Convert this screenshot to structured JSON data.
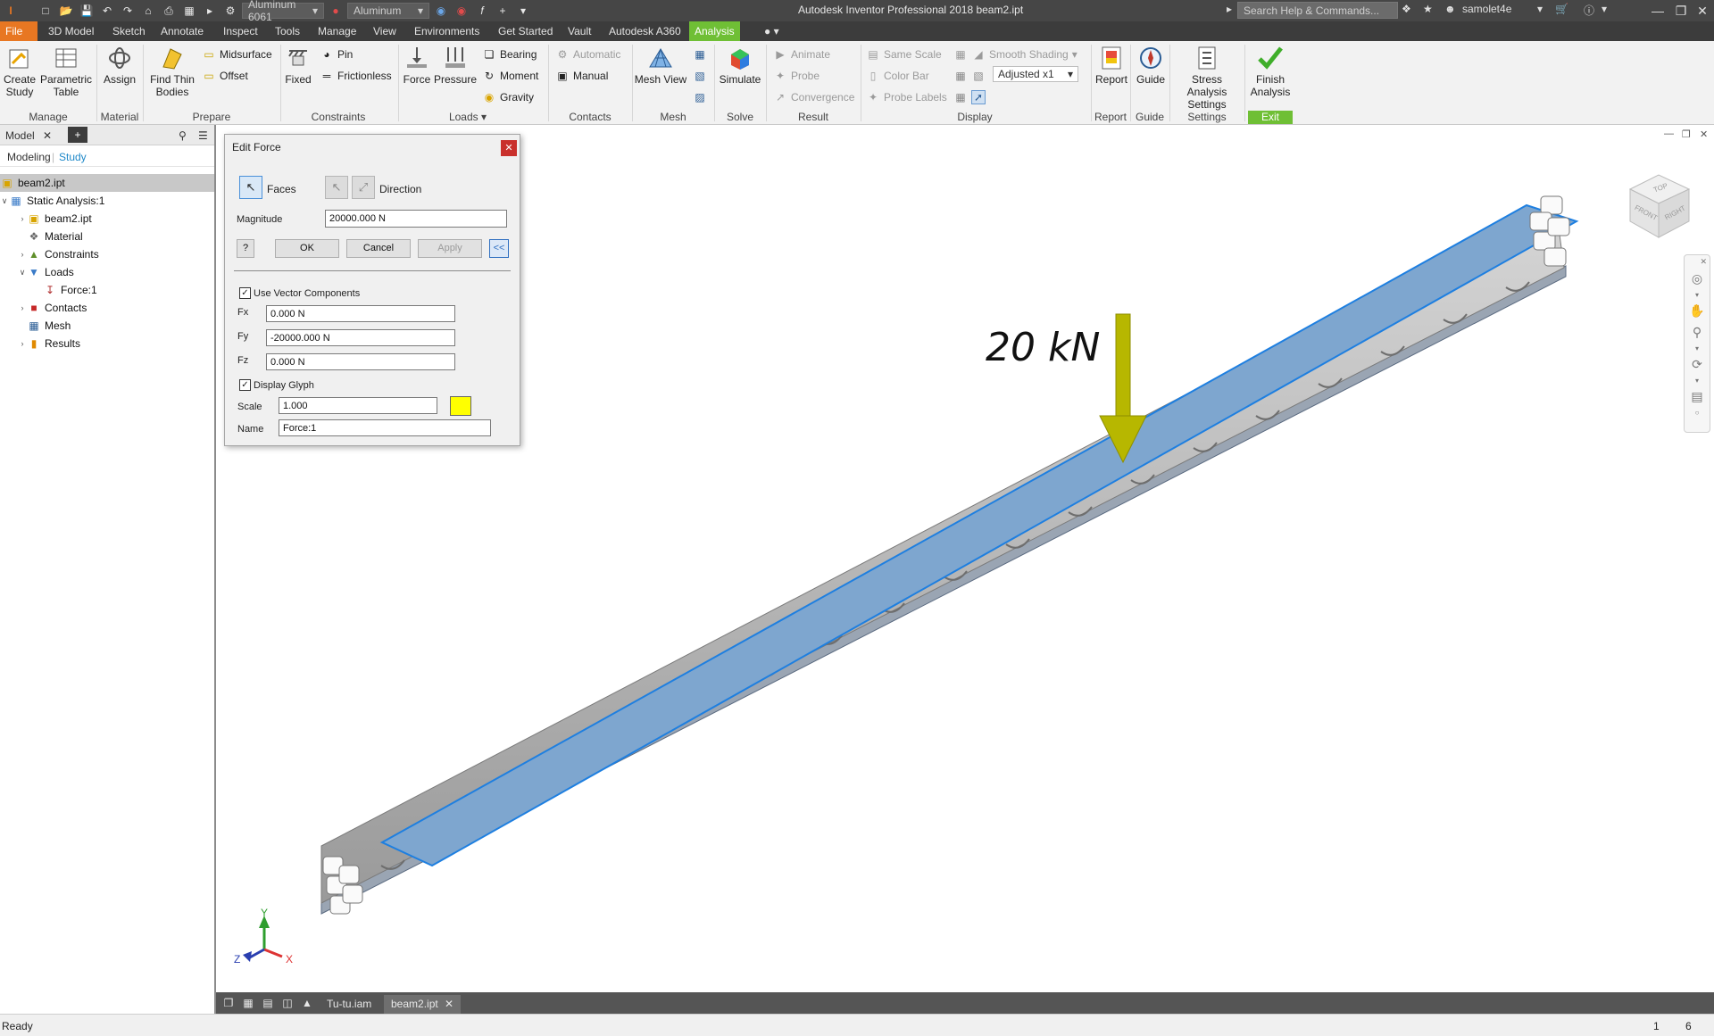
{
  "titlebar": {
    "title": "Autodesk Inventor Professional 2018   beam2.ipt",
    "material_dd": "Aluminum 6061",
    "appearance_dd": "Aluminum",
    "search_placeholder": "Search Help & Commands...",
    "user": "samolet4e"
  },
  "tabs": [
    "File",
    "3D Model",
    "Sketch",
    "Annotate",
    "Inspect",
    "Tools",
    "Manage",
    "View",
    "Environments",
    "Get Started",
    "Vault",
    "Autodesk A360",
    "Analysis"
  ],
  "ribbon": {
    "create_study": "Create\nStudy",
    "parametric_table": "Parametric\nTable",
    "assign": "Assign",
    "find_thin_bodies": "Find Thin\nBodies",
    "midsurface": "Midsurface",
    "offset": "Offset",
    "fixed": "Fixed",
    "pin": "Pin",
    "frictionless": "Frictionless",
    "force": "Force",
    "pressure": "Pressure",
    "bearing": "Bearing",
    "moment": "Moment",
    "gravity": "Gravity",
    "automatic": "Automatic",
    "manual": "Manual",
    "mesh_view": "Mesh View",
    "simulate": "Simulate",
    "animate": "Animate",
    "probe": "Probe",
    "convergence": "Convergence",
    "same_scale": "Same Scale",
    "color_bar": "Color Bar",
    "probe_labels": "Probe Labels",
    "smooth_shading": "Smooth Shading",
    "adjusted": "Adjusted x1",
    "report": "Report",
    "guide": "Guide",
    "stress_settings": "Stress Analysis\nSettings",
    "finish_analysis": "Finish\nAnalysis",
    "groups": {
      "manage": "Manage",
      "material": "Material",
      "prepare": "Prepare",
      "constraints": "Constraints",
      "loads": "Loads",
      "contacts": "Contacts",
      "mesh": "Mesh",
      "solve": "Solve",
      "result": "Result",
      "display": "Display",
      "report": "Report",
      "guide": "Guide",
      "settings": "Settings",
      "exit": "Exit"
    }
  },
  "browser": {
    "tab_label": "Model",
    "modeling": "Modeling",
    "study": "Study",
    "tree": [
      {
        "label": "beam2.ipt",
        "level": 0
      },
      {
        "label": "Static Analysis:1",
        "level": 1
      },
      {
        "label": "beam2.ipt",
        "level": 2
      },
      {
        "label": "Material",
        "level": 2
      },
      {
        "label": "Constraints",
        "level": 2
      },
      {
        "label": "Loads",
        "level": 2
      },
      {
        "label": "Force:1",
        "level": 3
      },
      {
        "label": "Contacts",
        "level": 2
      },
      {
        "label": "Mesh",
        "level": 2
      },
      {
        "label": "Results",
        "level": 2
      }
    ]
  },
  "dialog": {
    "title": "Edit Force",
    "faces": "Faces",
    "direction": "Direction",
    "magnitude_label": "Magnitude",
    "magnitude": "20000.000 N",
    "ok": "OK",
    "cancel": "Cancel",
    "apply": "Apply",
    "collapse": "<<",
    "use_vector": "Use Vector Components",
    "fx_label": "Fx",
    "fx": "0.000 N",
    "fy_label": "Fy",
    "fy": "-20000.000 N",
    "fz_label": "Fz",
    "fz": "0.000 N",
    "display_glyph": "Display Glyph",
    "scale_label": "Scale",
    "scale": "1.000",
    "name_label": "Name",
    "name": "Force:1",
    "glyph_color": "#ffff00"
  },
  "viewport": {
    "load_label": "20 kN",
    "axis_x": "X",
    "axis_y": "Y",
    "axis_z": "Z",
    "cube_front": "FRONT",
    "cube_right": "RIGHT",
    "cube_top": "TOP"
  },
  "doctabs": [
    "Tu-tu.iam",
    "beam2.ipt"
  ],
  "status": {
    "text": "Ready",
    "n1": "1",
    "n2": "6"
  },
  "colors": {
    "accent_green": "#6fbf35",
    "file_orange": "#e87722",
    "beam_blue": "#7ea6cf",
    "arrow": "#b7b700"
  }
}
